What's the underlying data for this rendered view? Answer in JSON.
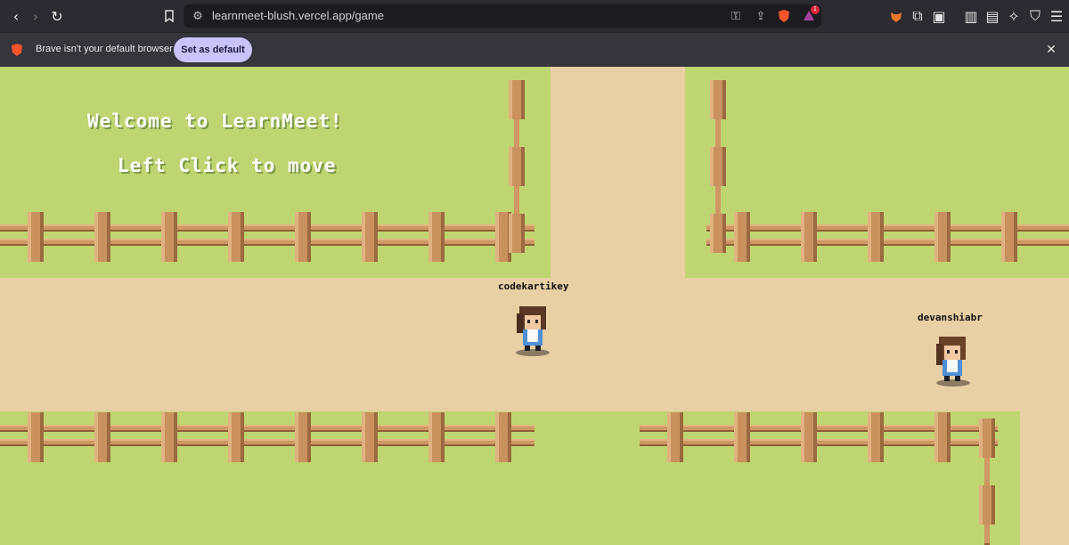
{
  "browser": {
    "url": "learnmeet-blush.vercel.app/game",
    "nav_icons": [
      "back-icon",
      "forward-icon",
      "reload-icon",
      "bookmark-icon"
    ],
    "url_icons": [
      "site-settings-icon",
      "key-icon",
      "share-icon",
      "brave-shields-icon",
      "brave-rewards-icon"
    ],
    "right_icons": [
      "wallet-fox-icon",
      "extensions-icon",
      "tab-icon",
      "sidebar-icon",
      "wallet-icon",
      "leo-ai-icon",
      "vpn-icon",
      "menu-icon"
    ],
    "rewards_badge": "1"
  },
  "infobar": {
    "message": "Brave isn't your default browser",
    "button_label": "Set as default",
    "close_icon": "close-icon"
  },
  "game": {
    "welcome": "Welcome to LearnMeet!",
    "hint": "Left Click to move",
    "players": [
      {
        "name": "codekartikey"
      },
      {
        "name": "devanshiabr"
      }
    ],
    "colors": {
      "grass": "#bfd571",
      "path": "#e9cfa4",
      "wood": "#c9915e"
    }
  }
}
